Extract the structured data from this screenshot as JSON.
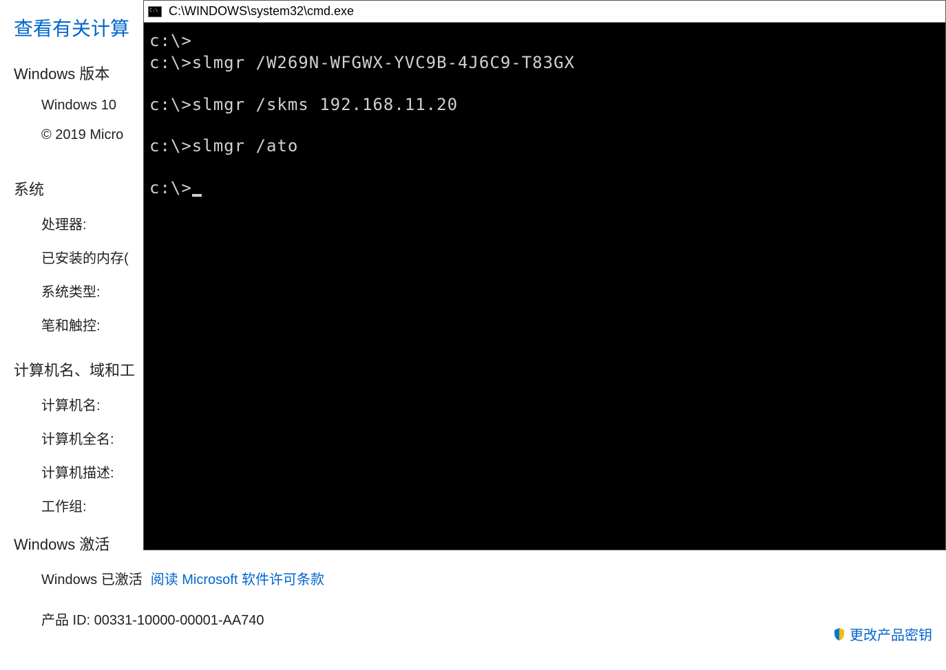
{
  "system_info": {
    "heading": "查看有关计算",
    "windows_version_label": "Windows 版本",
    "windows_edition": "Windows 10",
    "copyright": "© 2019 Micro",
    "system_label": "系统",
    "processor_label": "处理器:",
    "ram_label": "已安装的内存(",
    "system_type_label": "系统类型:",
    "pen_touch_label": "笔和触控:",
    "computer_name_domain_label": "计算机名、域和工",
    "computer_name_label": "计算机名:",
    "full_computer_name_label": "计算机全名:",
    "computer_description_label": "计算机描述:",
    "workgroup_label": "工作组:",
    "activation_section_label": "Windows 激活",
    "activation_status": "Windows 已激活",
    "license_link": "阅读 Microsoft 软件许可条款",
    "product_id_label": "产品 ID: 00331-10000-00001-AA740",
    "change_key_link": "更改产品密钥"
  },
  "cmd": {
    "title": "C:\\WINDOWS\\system32\\cmd.exe",
    "lines": [
      "c:\\>",
      "c:\\>slmgr /W269N-WFGWX-YVC9B-4J6C9-T83GX",
      "",
      "c:\\>slmgr /skms 192.168.11.20",
      "",
      "c:\\>slmgr /ato",
      "",
      "c:\\>"
    ],
    "prompt_final": "c:\\>"
  }
}
